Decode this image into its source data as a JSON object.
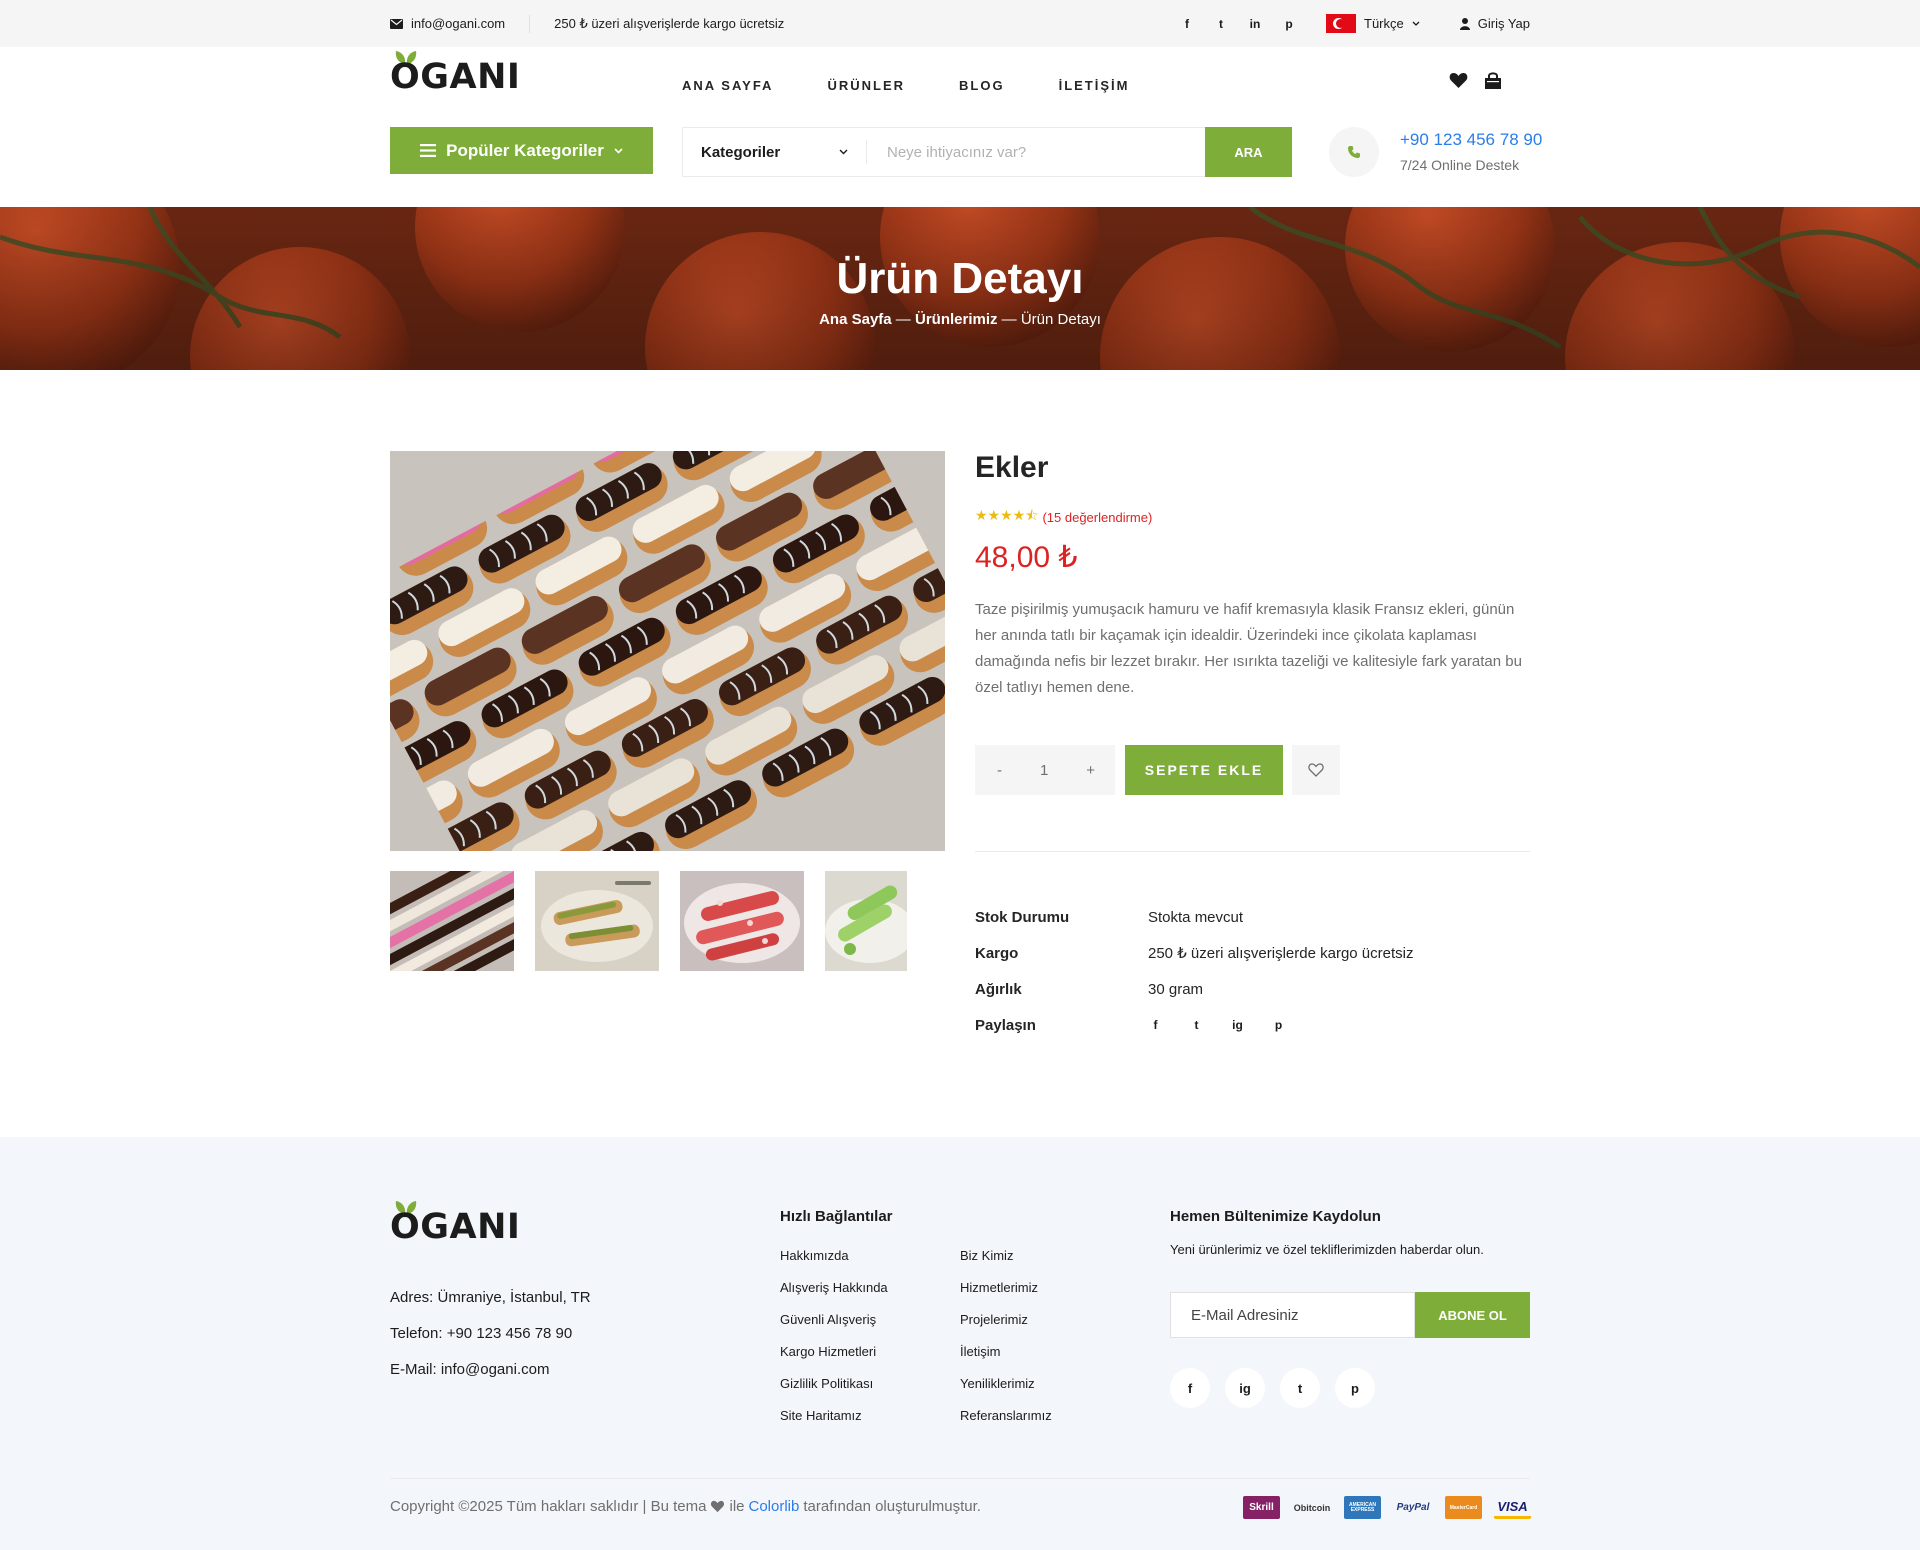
{
  "topbar": {
    "email": "info@ogani.com",
    "shipping_note": "250 ₺ üzeri alışverişlerde kargo ücretsiz",
    "social": [
      "f",
      "t",
      "in",
      "p"
    ],
    "language": "Türkçe",
    "login": "Giriş Yap"
  },
  "header": {
    "logo": "OGANI",
    "nav": [
      "ANA SAYFA",
      "ÜRÜNLER",
      "BLOG",
      "İLETİŞİM"
    ],
    "categories_button": "Popüler Kategoriler",
    "search": {
      "category": "Kategoriler",
      "placeholder": "Neye ihtiyacınız var?",
      "button": "ARA"
    },
    "phone": "+90 123 456 78 90",
    "support": "7/24 Online Destek"
  },
  "hero": {
    "title": "Ürün Detayı",
    "breadcrumb": [
      "Ana Sayfa",
      "Ürünlerimiz",
      "Ürün Detayı"
    ]
  },
  "product": {
    "name": "Ekler",
    "rating": 4.5,
    "reviews": "(15 değerlendirme)",
    "price": "48,00 ₺",
    "description": "Taze pişirilmiş yumuşacık hamuru ve hafif kremasıyla klasik Fransız ekleri, günün her anında tatlı bir kaçamak için idealdir. Üzerindeki ince çikolata kaplaması damağında nefis bir lezzet bırakır. Her ısırıkta tazeliği ve kalitesiyle fark yaratan bu özel tatlıyı hemen dene.",
    "quantity": "1",
    "qty_minus": "-",
    "qty_plus": "+",
    "add_to_cart": "SEPETE EKLE",
    "info": [
      {
        "key": "Stok Durumu",
        "value": "Stokta mevcut"
      },
      {
        "key": "Kargo",
        "value": "250 ₺ üzeri alışverişlerde kargo ücretsiz"
      },
      {
        "key": "Ağırlık",
        "value": "30 gram"
      }
    ],
    "share_label": "Paylaşın",
    "share_icons": [
      "f",
      "t",
      "ig",
      "p"
    ]
  },
  "footer": {
    "logo": "OGANI",
    "address": "Adres: Ümraniye, İstanbul, TR",
    "phone": "Telefon: +90 123 456 78 90",
    "email": "E-Mail: info@ogani.com",
    "links_title": "Hızlı Bağlantılar",
    "links_a": [
      "Hakkımızda",
      "Alışveriş Hakkında",
      "Güvenli Alışveriş",
      "Kargo Hizmetleri",
      "Gizlilik Politikası",
      "Site Haritamız"
    ],
    "links_b": [
      "Biz Kimiz",
      "Hizmetlerimiz",
      "Projelerimiz",
      "İletişim",
      "Yeniliklerimiz",
      "Referanslarımız"
    ],
    "newsletter_title": "Hemen Bültenimize Kaydolun",
    "newsletter_sub": "Yeni ürünlerimiz ve özel tekliflerimizden haberdar olun.",
    "newsletter_placeholder": "E-Mail Adresiniz",
    "newsletter_button": "ABONE OL",
    "social": [
      "f",
      "ig",
      "t",
      "p"
    ],
    "copyright_pre": "Copyright ©2025 Tüm hakları saklıdır | Bu tema",
    "copyright_mid": "ile",
    "copyright_link": "Colorlib",
    "copyright_post": "tarafından oluşturulmuştur.",
    "payments": [
      "Skrill",
      "Obitcoin",
      "AMERICAN EXPRESS",
      "PayPal",
      "MasterCard",
      "VISA"
    ]
  },
  "colors": {
    "accent": "#7fad39",
    "price": "#dd2222",
    "link": "#2b7de9",
    "stars": "#edbb0e"
  }
}
